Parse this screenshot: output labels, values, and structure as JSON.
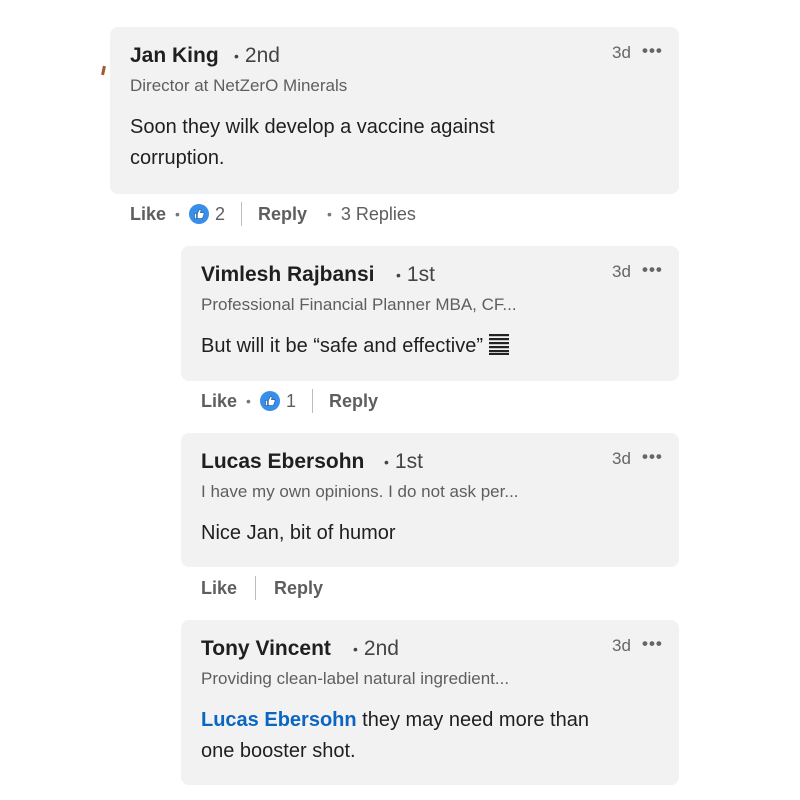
{
  "comments": [
    {
      "name": "Jan King",
      "degree": "2nd",
      "headline": "Director at NetZerO Minerals",
      "time": "3d",
      "text_lines": [
        "Soon they wilk develop a vaccine against",
        "corruption."
      ],
      "actions": {
        "like_label": "Like",
        "like_count": "2",
        "reply_label": "Reply",
        "replies_label": "3 Replies"
      }
    },
    {
      "name": "Vimlesh Rajbansi",
      "degree": "1st",
      "headline": "Professional Financial Planner MBA, CF...",
      "time": "3d",
      "text_lines": [
        "But will it be “safe and effective”"
      ],
      "emoji": "abacus-emoji",
      "actions": {
        "like_label": "Like",
        "like_count": "1",
        "reply_label": "Reply"
      }
    },
    {
      "name": "Lucas Ebersohn",
      "degree": "1st",
      "headline": "I have my own opinions. I do not ask per...",
      "time": "3d",
      "text_lines": [
        "Nice Jan, bit of humor"
      ],
      "actions": {
        "like_label": "Like",
        "reply_label": "Reply"
      }
    },
    {
      "name": "Tony Vincent",
      "degree": "2nd",
      "headline": "Providing clean-label natural ingredient...",
      "time": "3d",
      "mention": "Lucas Ebersohn",
      "text_lines": [
        " they may need more than",
        "one booster shot."
      ]
    }
  ],
  "icons": {
    "more": "more-options-icon",
    "reaction": "like-reaction-icon"
  },
  "colors": {
    "bubble": "#f2f2f2",
    "mention": "#0a66c2",
    "like_icon": "#378fe9"
  }
}
